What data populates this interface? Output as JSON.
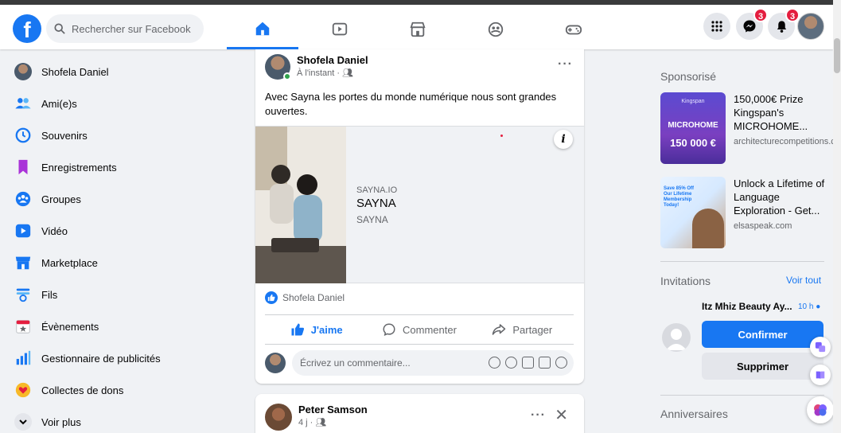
{
  "header": {
    "search_placeholder": "Rechercher sur Facebook",
    "messenger_badge": "3",
    "notifications_badge": "3"
  },
  "sidebar": {
    "items": [
      {
        "label": "Shofela Daniel",
        "icon": "profile-avatar"
      },
      {
        "label": "Ami(e)s",
        "icon": "friends-icon"
      },
      {
        "label": "Souvenirs",
        "icon": "memories-icon"
      },
      {
        "label": "Enregistrements",
        "icon": "bookmark-icon"
      },
      {
        "label": "Groupes",
        "icon": "groups-icon"
      },
      {
        "label": "Vidéo",
        "icon": "video-icon"
      },
      {
        "label": "Marketplace",
        "icon": "marketplace-icon"
      },
      {
        "label": "Fils",
        "icon": "feeds-icon"
      },
      {
        "label": "Évènements",
        "icon": "events-icon"
      },
      {
        "label": "Gestionnaire de publicités",
        "icon": "ads-manager-icon"
      },
      {
        "label": "Collectes de dons",
        "icon": "fundraiser-icon"
      },
      {
        "label": "Voir plus",
        "icon": "chevron-down-icon"
      }
    ]
  },
  "post1": {
    "author": "Shofela Daniel",
    "time": "À l'instant ·",
    "text": "Avec Sayna les portes du monde numérique nous sont grandes ouvertes.",
    "ad_domain": "SAYNA.IO",
    "ad_title": "SAYNA",
    "ad_subtitle": "SAYNA",
    "reaction_name": "Shofela Daniel",
    "like_label": "J'aime",
    "comment_label": "Commenter",
    "share_label": "Partager",
    "comment_placeholder": "Écrivez un commentaire..."
  },
  "post2": {
    "author": "Peter Samson",
    "time": "4 j ·"
  },
  "right": {
    "sponsored_title": "Sponsorisé",
    "sponsors": [
      {
        "title": "150,000€ Prize Kingspan's MICROHOME...",
        "domain": "architecturecompetitions.com",
        "img_caption": "MICROHOME",
        "img_amount": "150 000 €",
        "img_brand": "Kingspan"
      },
      {
        "title": "Unlock a Lifetime of Language Exploration - Get...",
        "domain": "elsaspeak.com",
        "img_caption": "Save 85% Off Our Lifetime Membership Today!"
      }
    ],
    "invitations_title": "Invitations",
    "see_all": "Voir tout",
    "request_name": "Itz Mhiz Beauty Ay...",
    "request_time": "10 h",
    "confirm_label": "Confirmer",
    "delete_label": "Supprimer",
    "birthdays_title": "Anniversaires"
  },
  "colors": {
    "brand": "#1877f2",
    "badge": "#e41e3f",
    "background": "#f0f2f5"
  }
}
